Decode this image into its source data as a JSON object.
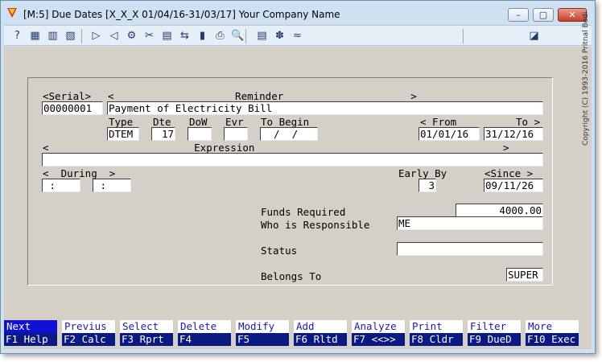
{
  "window": {
    "title": "[M:5]  Due Dates  [X_X_X  01/04/16-31/03/17]  Your Company Name"
  },
  "window_controls": {
    "minimize": "–",
    "maximize": "▢",
    "close": "✕"
  },
  "toolbar_icons": [
    "help-icon",
    "grid-icon",
    "table-icon",
    "report-icon",
    "forward-icon",
    "back-icon",
    "settings-icon",
    "tools-icon",
    "document-icon",
    "transfer-icon",
    "chart-icon",
    "print-icon",
    "find-icon",
    "notes-icon",
    "config-icon",
    "link-icon",
    "monitor-icon"
  ],
  "toolbar_glyphs": [
    "?",
    "▦",
    "▥",
    "▧",
    "▷",
    "◁",
    "⚙",
    "✂",
    "▤",
    "⇆",
    "▮",
    "⎙",
    "🔍",
    "▤",
    "✽",
    "≈",
    "◪"
  ],
  "labels": {
    "serial": "<Serial>",
    "reminder": "<                    Reminder                     >",
    "type": "Type",
    "dte": "Dte",
    "dow": "DoW",
    "evr": "Evr",
    "to_begin": "To Begin",
    "from": "< From",
    "to": "To >",
    "expression": "<                        Expression                                         >",
    "during": "<  During  >",
    "early_by": "Early By",
    "since": "<Since >",
    "funds_required": "Funds Required",
    "who_responsible": "Who is Responsible",
    "status": "Status",
    "belongs_to": "Belongs To"
  },
  "fields": {
    "serial": "00000001",
    "reminder": "Payment of Electricity Bill",
    "type": "DTEM",
    "dte": "17",
    "dow": "",
    "evr": "",
    "to_begin": "  /  /",
    "from": "01/01/16",
    "to": "31/12/16",
    "expression": "",
    "during_1": " :",
    "during_2": " :",
    "early_by": "3",
    "since": "09/11/26",
    "funds_required": "4000.00",
    "who_responsible": "ME",
    "status": "",
    "belongs_to": "SUPER"
  },
  "copyright": "Copyright (C) 1993-2016 Pritnal Bedi",
  "function_keys": [
    {
      "action": "Next",
      "key": "F1 Help"
    },
    {
      "action": "Previus",
      "key": "F2 Calc"
    },
    {
      "action": "Select",
      "key": "F3 Rprt"
    },
    {
      "action": "Delete",
      "key": "F4"
    },
    {
      "action": "Modify",
      "key": "F5"
    },
    {
      "action": "Add",
      "key": "F6 Rltd"
    },
    {
      "action": "Analyze",
      "key": "F7 <<>>"
    },
    {
      "action": "Print",
      "key": "F8 Cldr"
    },
    {
      "action": "Filter",
      "key": "F9 DueD"
    },
    {
      "action": "More",
      "key": "F10 Exec"
    }
  ]
}
